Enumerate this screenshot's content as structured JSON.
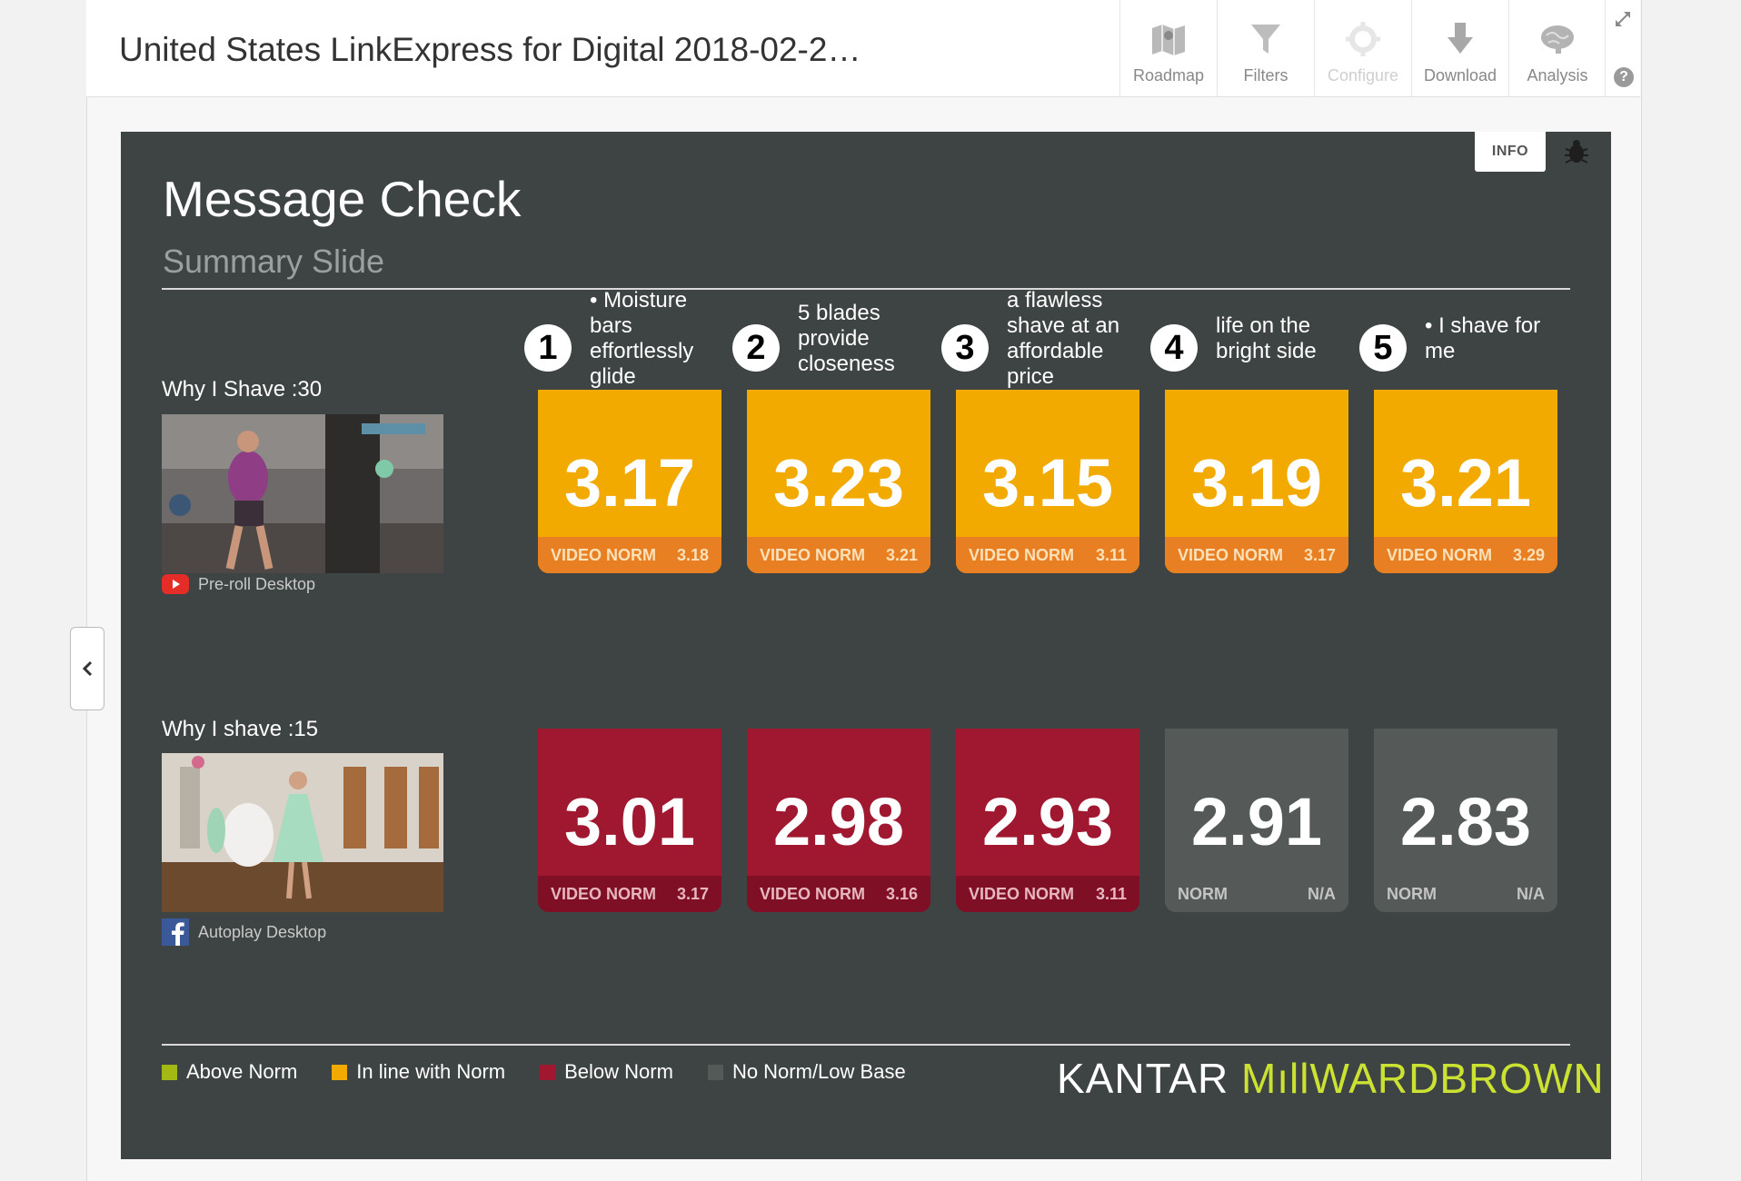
{
  "app": {
    "title": "United States LinkExpress for Digital 2018-02-2…",
    "toolbar": [
      {
        "label": "Roadmap",
        "icon": "map-icon",
        "enabled": true
      },
      {
        "label": "Filters",
        "icon": "funnel-icon",
        "enabled": true
      },
      {
        "label": "Configure",
        "icon": "gear-icon",
        "enabled": false
      },
      {
        "label": "Download",
        "icon": "download-icon",
        "enabled": true
      },
      {
        "label": "Analysis",
        "icon": "brain-icon",
        "enabled": true
      }
    ],
    "help_glyph": "?"
  },
  "slide": {
    "info_label": "INFO",
    "title": "Message Check",
    "subtitle": "Summary Slide",
    "messages": [
      {
        "num": "1",
        "text": "• Moisture bars effortlessly glide"
      },
      {
        "num": "2",
        "text": "5 blades provide closeness"
      },
      {
        "num": "3",
        "text": "a flawless shave at an affordable price"
      },
      {
        "num": "4",
        "text": "life on the bright side"
      },
      {
        "num": "5",
        "text": "• I shave for me"
      }
    ],
    "ads": [
      {
        "label": "Why I Shave :30",
        "platform": "Pre-roll Desktop",
        "platform_icon": "youtube-icon",
        "tiles": [
          {
            "score": "3.17",
            "norm_label": "VIDEO NORM",
            "norm_value": "3.18",
            "status": "inline"
          },
          {
            "score": "3.23",
            "norm_label": "VIDEO NORM",
            "norm_value": "3.21",
            "status": "inline"
          },
          {
            "score": "3.15",
            "norm_label": "VIDEO NORM",
            "norm_value": "3.11",
            "status": "inline"
          },
          {
            "score": "3.19",
            "norm_label": "VIDEO NORM",
            "norm_value": "3.17",
            "status": "inline"
          },
          {
            "score": "3.21",
            "norm_label": "VIDEO NORM",
            "norm_value": "3.29",
            "status": "inline"
          }
        ]
      },
      {
        "label": "Why I shave :15",
        "platform": "Autoplay Desktop",
        "platform_icon": "facebook-icon",
        "tiles": [
          {
            "score": "3.01",
            "norm_label": "VIDEO NORM",
            "norm_value": "3.17",
            "status": "below"
          },
          {
            "score": "2.98",
            "norm_label": "VIDEO NORM",
            "norm_value": "3.16",
            "status": "below"
          },
          {
            "score": "2.93",
            "norm_label": "VIDEO NORM",
            "norm_value": "3.11",
            "status": "below"
          },
          {
            "score": "2.91",
            "norm_label": "NORM",
            "norm_value": "N/A",
            "status": "nonorm"
          },
          {
            "score": "2.83",
            "norm_label": "NORM",
            "norm_value": "N/A",
            "status": "nonorm"
          }
        ]
      }
    ],
    "legend": [
      {
        "label": "Above Norm",
        "color": "#a4b813"
      },
      {
        "label": "In line with Norm",
        "color": "#f2a900"
      },
      {
        "label": "Below Norm",
        "color": "#a01830"
      },
      {
        "label": "No Norm/Low Base",
        "color": "#555a59"
      }
    ],
    "brand": {
      "part1": "KANTAR ",
      "part2": "MıllWARDBROWN"
    }
  },
  "colors": {
    "inline_tile": "#f2a900",
    "inline_norm_bar": "#e87f22",
    "inline_norm_text": "#fbe0b8",
    "below_tile": "#a01830",
    "below_norm_bar": "#7e0f24",
    "below_norm_text": "#e7b7c0",
    "nonorm_tile": "#555a59",
    "nonorm_norm_text": "#c4c4c4",
    "slide_bg": "#3e4443"
  }
}
